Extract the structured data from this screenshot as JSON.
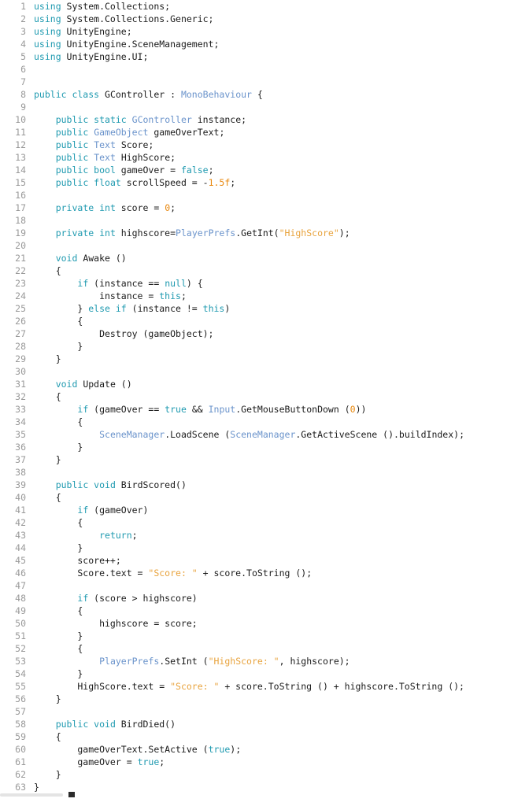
{
  "editor": {
    "language": "csharp",
    "background_color": "#ffffff",
    "gutter_color": "#999999",
    "text_color": "#1a1a1a",
    "keyword_color": "#1f9ab0",
    "type_color": "#6a93cb",
    "string_color": "#e8a33d",
    "number_color": "#e8870c",
    "total_lines": 63,
    "first_visible_line": 1,
    "last_visible_line": 63,
    "caret_line": 63,
    "scrollbar": {
      "orientation": "horizontal",
      "color": "#e4e4e4"
    }
  },
  "lines": [
    {
      "n": "1",
      "tokens": [
        {
          "t": "k",
          "v": "using"
        },
        {
          "t": "p",
          "v": " System.Collections;"
        }
      ]
    },
    {
      "n": "2",
      "tokens": [
        {
          "t": "k",
          "v": "using"
        },
        {
          "t": "p",
          "v": " System.Collections.Generic;"
        }
      ]
    },
    {
      "n": "3",
      "tokens": [
        {
          "t": "k",
          "v": "using"
        },
        {
          "t": "p",
          "v": " UnityEngine;"
        }
      ]
    },
    {
      "n": "4",
      "tokens": [
        {
          "t": "k",
          "v": "using"
        },
        {
          "t": "p",
          "v": " UnityEngine.SceneManagement;"
        }
      ]
    },
    {
      "n": "5",
      "tokens": [
        {
          "t": "k",
          "v": "using"
        },
        {
          "t": "p",
          "v": " UnityEngine.UI;"
        }
      ]
    },
    {
      "n": "6",
      "tokens": []
    },
    {
      "n": "7",
      "tokens": []
    },
    {
      "n": "8",
      "tokens": [
        {
          "t": "k",
          "v": "public class"
        },
        {
          "t": "p",
          "v": " GController : "
        },
        {
          "t": "t",
          "v": "MonoBehaviour"
        },
        {
          "t": "p",
          "v": " {"
        }
      ]
    },
    {
      "n": "9",
      "tokens": []
    },
    {
      "n": "10",
      "tokens": [
        {
          "t": "p",
          "v": "    "
        },
        {
          "t": "k",
          "v": "public static"
        },
        {
          "t": "p",
          "v": " "
        },
        {
          "t": "t",
          "v": "GController"
        },
        {
          "t": "p",
          "v": " instance;"
        }
      ]
    },
    {
      "n": "11",
      "tokens": [
        {
          "t": "p",
          "v": "    "
        },
        {
          "t": "k",
          "v": "public"
        },
        {
          "t": "p",
          "v": " "
        },
        {
          "t": "t",
          "v": "GameObject"
        },
        {
          "t": "p",
          "v": " gameOverText;"
        }
      ]
    },
    {
      "n": "12",
      "tokens": [
        {
          "t": "p",
          "v": "    "
        },
        {
          "t": "k",
          "v": "public"
        },
        {
          "t": "p",
          "v": " "
        },
        {
          "t": "t",
          "v": "Text"
        },
        {
          "t": "p",
          "v": " Score;"
        }
      ]
    },
    {
      "n": "13",
      "tokens": [
        {
          "t": "p",
          "v": "    "
        },
        {
          "t": "k",
          "v": "public"
        },
        {
          "t": "p",
          "v": " "
        },
        {
          "t": "t",
          "v": "Text"
        },
        {
          "t": "p",
          "v": " HighScore;"
        }
      ]
    },
    {
      "n": "14",
      "tokens": [
        {
          "t": "p",
          "v": "    "
        },
        {
          "t": "k",
          "v": "public bool"
        },
        {
          "t": "p",
          "v": " gameOver = "
        },
        {
          "t": "k",
          "v": "false"
        },
        {
          "t": "p",
          "v": ";"
        }
      ]
    },
    {
      "n": "15",
      "tokens": [
        {
          "t": "p",
          "v": "    "
        },
        {
          "t": "k",
          "v": "public float"
        },
        {
          "t": "p",
          "v": " scrollSpeed = -"
        },
        {
          "t": "n",
          "v": "1.5f"
        },
        {
          "t": "p",
          "v": ";"
        }
      ]
    },
    {
      "n": "16",
      "tokens": []
    },
    {
      "n": "17",
      "tokens": [
        {
          "t": "p",
          "v": "    "
        },
        {
          "t": "k",
          "v": "private int"
        },
        {
          "t": "p",
          "v": " score = "
        },
        {
          "t": "n",
          "v": "0"
        },
        {
          "t": "p",
          "v": ";"
        }
      ]
    },
    {
      "n": "18",
      "tokens": []
    },
    {
      "n": "19",
      "tokens": [
        {
          "t": "p",
          "v": "    "
        },
        {
          "t": "k",
          "v": "private int"
        },
        {
          "t": "p",
          "v": " highscore="
        },
        {
          "t": "t",
          "v": "PlayerPrefs"
        },
        {
          "t": "p",
          "v": ".GetInt("
        },
        {
          "t": "s",
          "v": "\"HighScore\""
        },
        {
          "t": "p",
          "v": ");"
        }
      ]
    },
    {
      "n": "20",
      "tokens": []
    },
    {
      "n": "21",
      "tokens": [
        {
          "t": "p",
          "v": "    "
        },
        {
          "t": "k",
          "v": "void"
        },
        {
          "t": "p",
          "v": " Awake ()"
        }
      ]
    },
    {
      "n": "22",
      "tokens": [
        {
          "t": "p",
          "v": "    {"
        }
      ]
    },
    {
      "n": "23",
      "tokens": [
        {
          "t": "p",
          "v": "        "
        },
        {
          "t": "k",
          "v": "if"
        },
        {
          "t": "p",
          "v": " (instance == "
        },
        {
          "t": "k",
          "v": "null"
        },
        {
          "t": "p",
          "v": ") {"
        }
      ]
    },
    {
      "n": "24",
      "tokens": [
        {
          "t": "p",
          "v": "            instance = "
        },
        {
          "t": "k",
          "v": "this"
        },
        {
          "t": "p",
          "v": ";"
        }
      ]
    },
    {
      "n": "25",
      "tokens": [
        {
          "t": "p",
          "v": "        } "
        },
        {
          "t": "k",
          "v": "else if"
        },
        {
          "t": "p",
          "v": " (instance != "
        },
        {
          "t": "k",
          "v": "this"
        },
        {
          "t": "p",
          "v": ")"
        }
      ]
    },
    {
      "n": "26",
      "tokens": [
        {
          "t": "p",
          "v": "        {"
        }
      ]
    },
    {
      "n": "27",
      "tokens": [
        {
          "t": "p",
          "v": "            Destroy (gameObject);"
        }
      ]
    },
    {
      "n": "28",
      "tokens": [
        {
          "t": "p",
          "v": "        }"
        }
      ]
    },
    {
      "n": "29",
      "tokens": [
        {
          "t": "p",
          "v": "    }"
        }
      ]
    },
    {
      "n": "30",
      "tokens": []
    },
    {
      "n": "31",
      "tokens": [
        {
          "t": "p",
          "v": "    "
        },
        {
          "t": "k",
          "v": "void"
        },
        {
          "t": "p",
          "v": " Update ()"
        }
      ]
    },
    {
      "n": "32",
      "tokens": [
        {
          "t": "p",
          "v": "    {"
        }
      ]
    },
    {
      "n": "33",
      "tokens": [
        {
          "t": "p",
          "v": "        "
        },
        {
          "t": "k",
          "v": "if"
        },
        {
          "t": "p",
          "v": " (gameOver == "
        },
        {
          "t": "k",
          "v": "true"
        },
        {
          "t": "p",
          "v": " && "
        },
        {
          "t": "t",
          "v": "Input"
        },
        {
          "t": "p",
          "v": ".GetMouseButtonDown ("
        },
        {
          "t": "n",
          "v": "0"
        },
        {
          "t": "p",
          "v": "))"
        }
      ]
    },
    {
      "n": "34",
      "tokens": [
        {
          "t": "p",
          "v": "        {"
        }
      ]
    },
    {
      "n": "35",
      "tokens": [
        {
          "t": "p",
          "v": "            "
        },
        {
          "t": "t",
          "v": "SceneManager"
        },
        {
          "t": "p",
          "v": ".LoadScene ("
        },
        {
          "t": "t",
          "v": "SceneManager"
        },
        {
          "t": "p",
          "v": ".GetActiveScene ().buildIndex);"
        }
      ]
    },
    {
      "n": "36",
      "tokens": [
        {
          "t": "p",
          "v": "        }"
        }
      ]
    },
    {
      "n": "37",
      "tokens": [
        {
          "t": "p",
          "v": "    }"
        }
      ]
    },
    {
      "n": "38",
      "tokens": []
    },
    {
      "n": "39",
      "tokens": [
        {
          "t": "p",
          "v": "    "
        },
        {
          "t": "k",
          "v": "public void"
        },
        {
          "t": "p",
          "v": " BirdScored()"
        }
      ]
    },
    {
      "n": "40",
      "tokens": [
        {
          "t": "p",
          "v": "    {"
        }
      ]
    },
    {
      "n": "41",
      "tokens": [
        {
          "t": "p",
          "v": "        "
        },
        {
          "t": "k",
          "v": "if"
        },
        {
          "t": "p",
          "v": " (gameOver)"
        }
      ]
    },
    {
      "n": "42",
      "tokens": [
        {
          "t": "p",
          "v": "        {"
        }
      ]
    },
    {
      "n": "43",
      "tokens": [
        {
          "t": "p",
          "v": "            "
        },
        {
          "t": "k",
          "v": "return"
        },
        {
          "t": "p",
          "v": ";"
        }
      ]
    },
    {
      "n": "44",
      "tokens": [
        {
          "t": "p",
          "v": "        }"
        }
      ]
    },
    {
      "n": "45",
      "tokens": [
        {
          "t": "p",
          "v": "        score++;"
        }
      ]
    },
    {
      "n": "46",
      "tokens": [
        {
          "t": "p",
          "v": "        Score.text = "
        },
        {
          "t": "s",
          "v": "\"Score: \""
        },
        {
          "t": "p",
          "v": " + score.ToString ();"
        }
      ]
    },
    {
      "n": "47",
      "tokens": []
    },
    {
      "n": "48",
      "tokens": [
        {
          "t": "p",
          "v": "        "
        },
        {
          "t": "k",
          "v": "if"
        },
        {
          "t": "p",
          "v": " (score > highscore)"
        }
      ]
    },
    {
      "n": "49",
      "tokens": [
        {
          "t": "p",
          "v": "        {"
        }
      ]
    },
    {
      "n": "50",
      "tokens": [
        {
          "t": "p",
          "v": "            highscore = score;"
        }
      ]
    },
    {
      "n": "51",
      "tokens": [
        {
          "t": "p",
          "v": "        }"
        }
      ]
    },
    {
      "n": "52",
      "tokens": [
        {
          "t": "p",
          "v": "        {"
        }
      ]
    },
    {
      "n": "53",
      "tokens": [
        {
          "t": "p",
          "v": "            "
        },
        {
          "t": "t",
          "v": "PlayerPrefs"
        },
        {
          "t": "p",
          "v": ".SetInt ("
        },
        {
          "t": "s",
          "v": "\"HighScore: \""
        },
        {
          "t": "p",
          "v": ", highscore);"
        }
      ]
    },
    {
      "n": "54",
      "tokens": [
        {
          "t": "p",
          "v": "        }"
        }
      ]
    },
    {
      "n": "55",
      "tokens": [
        {
          "t": "p",
          "v": "        HighScore.text = "
        },
        {
          "t": "s",
          "v": "\"Score: \""
        },
        {
          "t": "p",
          "v": " + score.ToString () + highscore.ToString ();"
        }
      ]
    },
    {
      "n": "56",
      "tokens": [
        {
          "t": "p",
          "v": "    }"
        }
      ]
    },
    {
      "n": "57",
      "tokens": []
    },
    {
      "n": "58",
      "tokens": [
        {
          "t": "p",
          "v": "    "
        },
        {
          "t": "k",
          "v": "public void"
        },
        {
          "t": "p",
          "v": " BirdDied()"
        }
      ]
    },
    {
      "n": "59",
      "tokens": [
        {
          "t": "p",
          "v": "    {"
        }
      ]
    },
    {
      "n": "60",
      "tokens": [
        {
          "t": "p",
          "v": "        gameOverText.SetActive ("
        },
        {
          "t": "k",
          "v": "true"
        },
        {
          "t": "p",
          "v": ");"
        }
      ]
    },
    {
      "n": "61",
      "tokens": [
        {
          "t": "p",
          "v": "        gameOver = "
        },
        {
          "t": "k",
          "v": "true"
        },
        {
          "t": "p",
          "v": ";"
        }
      ]
    },
    {
      "n": "62",
      "tokens": [
        {
          "t": "p",
          "v": "    }"
        }
      ]
    },
    {
      "n": "63",
      "tokens": [
        {
          "t": "p",
          "v": "}"
        }
      ]
    }
  ]
}
